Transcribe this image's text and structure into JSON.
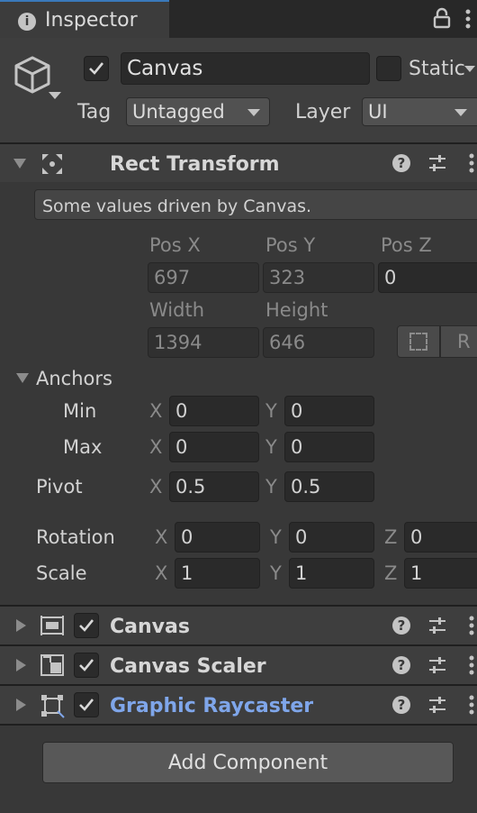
{
  "tab": {
    "title": "Inspector"
  },
  "object": {
    "name": "Canvas",
    "active": true,
    "static_label": "Static",
    "tag_label": "Tag",
    "tag_value": "Untagged",
    "layer_label": "Layer",
    "layer_value": "UI"
  },
  "rect_transform": {
    "title": "Rect Transform",
    "info": "Some values driven by Canvas.",
    "pos_x_label": "Pos X",
    "pos_y_label": "Pos Y",
    "pos_z_label": "Pos Z",
    "pos_x": "697",
    "pos_y": "323",
    "pos_z": "0",
    "width_label": "Width",
    "height_label": "Height",
    "width": "1394",
    "height": "646",
    "raw_label": "R",
    "anchors_label": "Anchors",
    "min_label": "Min",
    "max_label": "Max",
    "x_label": "X",
    "y_label": "Y",
    "z_label": "Z",
    "anchor_min_x": "0",
    "anchor_min_y": "0",
    "anchor_max_x": "0",
    "anchor_max_y": "0",
    "pivot_label": "Pivot",
    "pivot_x": "0.5",
    "pivot_y": "0.5",
    "rotation_label": "Rotation",
    "rotation_x": "0",
    "rotation_y": "0",
    "rotation_z": "0",
    "scale_label": "Scale",
    "scale_x": "1",
    "scale_y": "1",
    "scale_z": "1"
  },
  "components": [
    {
      "name": "Canvas",
      "enabled": true,
      "color": "#d7d7d7"
    },
    {
      "name": "Canvas Scaler",
      "enabled": true,
      "color": "#d7d7d7"
    },
    {
      "name": "Graphic Raycaster",
      "enabled": true,
      "color": "#7fa6ea"
    }
  ],
  "add_component_label": "Add Component",
  "icons": [
    "info-icon",
    "lock-icon",
    "kebab-menu-icon",
    "gameobject-cube-icon",
    "rect-transform-icon",
    "help-icon",
    "preset-sliders-icon",
    "canvas-icon",
    "canvas-scaler-icon",
    "graphic-raycaster-icon",
    "blueprint-icon"
  ]
}
